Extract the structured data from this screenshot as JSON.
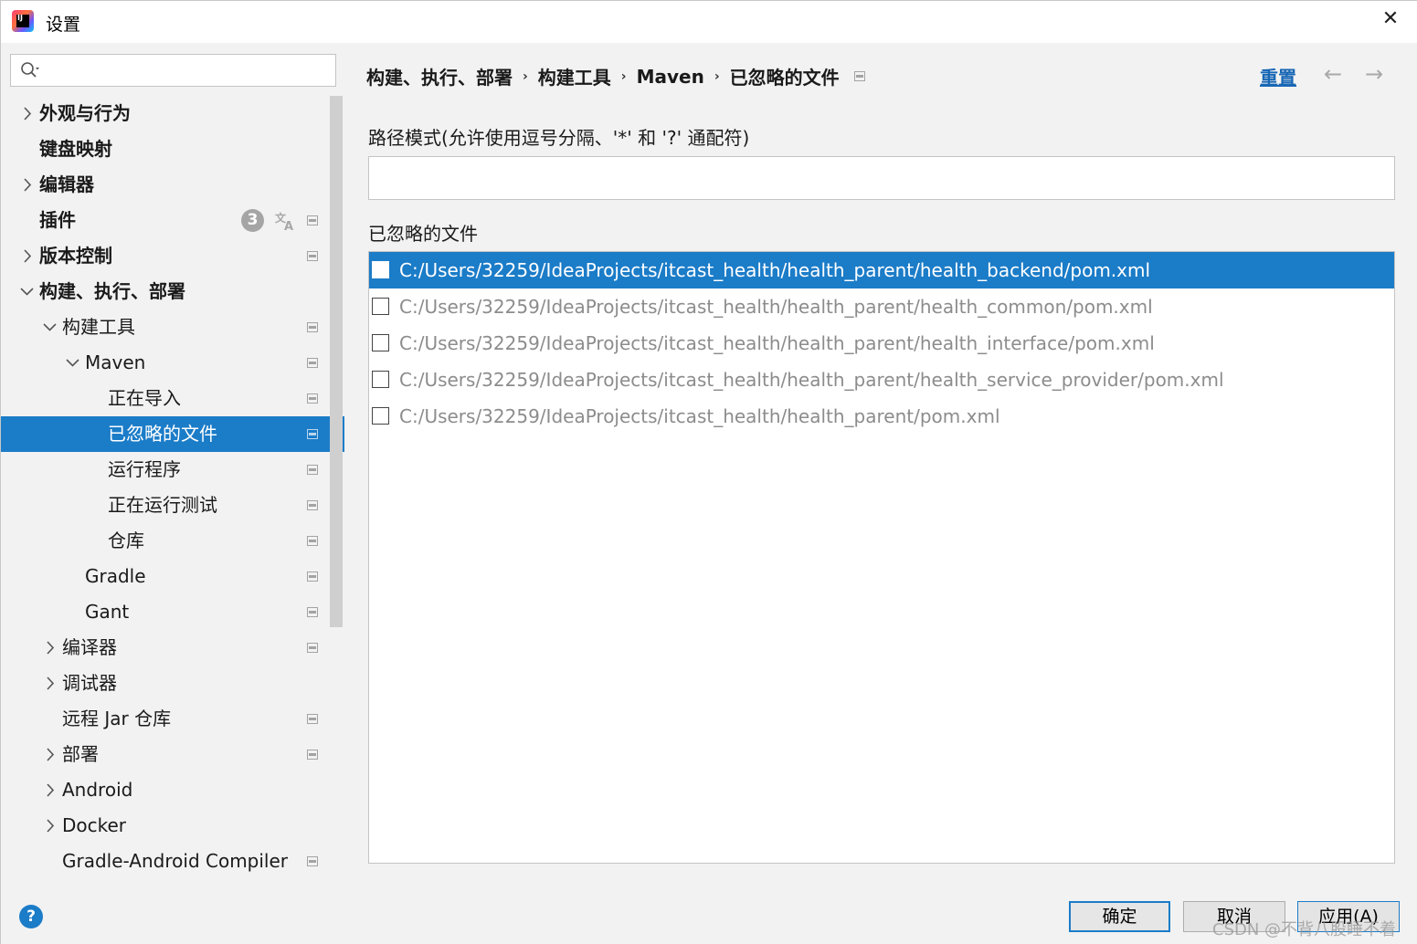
{
  "window": {
    "title": "设置",
    "close_glyph": "✕"
  },
  "search": {
    "placeholder": "",
    "value": ""
  },
  "sidebar": {
    "items": [
      {
        "label": "外观与行为"
      },
      {
        "label": "键盘映射"
      },
      {
        "label": "编辑器"
      },
      {
        "label": "插件",
        "badge": "3"
      },
      {
        "label": "版本控制"
      },
      {
        "label": "构建、执行、部署"
      },
      {
        "label": "构建工具"
      },
      {
        "label": "Maven"
      },
      {
        "label": "正在导入"
      },
      {
        "label": "已忽略的文件"
      },
      {
        "label": "运行程序"
      },
      {
        "label": "正在运行测试"
      },
      {
        "label": "仓库"
      },
      {
        "label": "Gradle"
      },
      {
        "label": "Gant"
      },
      {
        "label": "编译器"
      },
      {
        "label": "调试器"
      },
      {
        "label": "远程 Jar 仓库"
      },
      {
        "label": "部署"
      },
      {
        "label": "Android"
      },
      {
        "label": "Docker"
      },
      {
        "label": "Gradle-Android Compiler"
      }
    ]
  },
  "breadcrumb": {
    "items": [
      "构建、执行、部署",
      "构建工具",
      "Maven",
      "已忽略的文件"
    ],
    "separator": "›"
  },
  "header": {
    "reset_label": "重置",
    "back_glyph": "←",
    "forward_glyph": "→"
  },
  "form": {
    "pattern_label": "路径模式(允许使用逗号分隔、'*' 和 '?' 通配符)",
    "pattern_value": "",
    "ignored_label": "已忽略的文件"
  },
  "files": [
    {
      "path": "C:/Users/32259/IdeaProjects/itcast_health/health_parent/health_backend/pom.xml",
      "checked": false,
      "selected": true
    },
    {
      "path": "C:/Users/32259/IdeaProjects/itcast_health/health_parent/health_common/pom.xml",
      "checked": false,
      "selected": false
    },
    {
      "path": "C:/Users/32259/IdeaProjects/itcast_health/health_parent/health_interface/pom.xml",
      "checked": false,
      "selected": false
    },
    {
      "path": "C:/Users/32259/IdeaProjects/itcast_health/health_parent/health_service_provider/pom.xml",
      "checked": false,
      "selected": false
    },
    {
      "path": "C:/Users/32259/IdeaProjects/itcast_health/health_parent/pom.xml",
      "checked": false,
      "selected": false
    }
  ],
  "footer": {
    "help_glyph": "?",
    "ok_label": "确定",
    "cancel_label": "取消",
    "apply_label": "应用(A)",
    "watermark": "CSDN @不背八股睡不着"
  },
  "colors": {
    "selection": "#1b7cc8",
    "link": "#1867b5",
    "background": "#f2f2f2"
  }
}
